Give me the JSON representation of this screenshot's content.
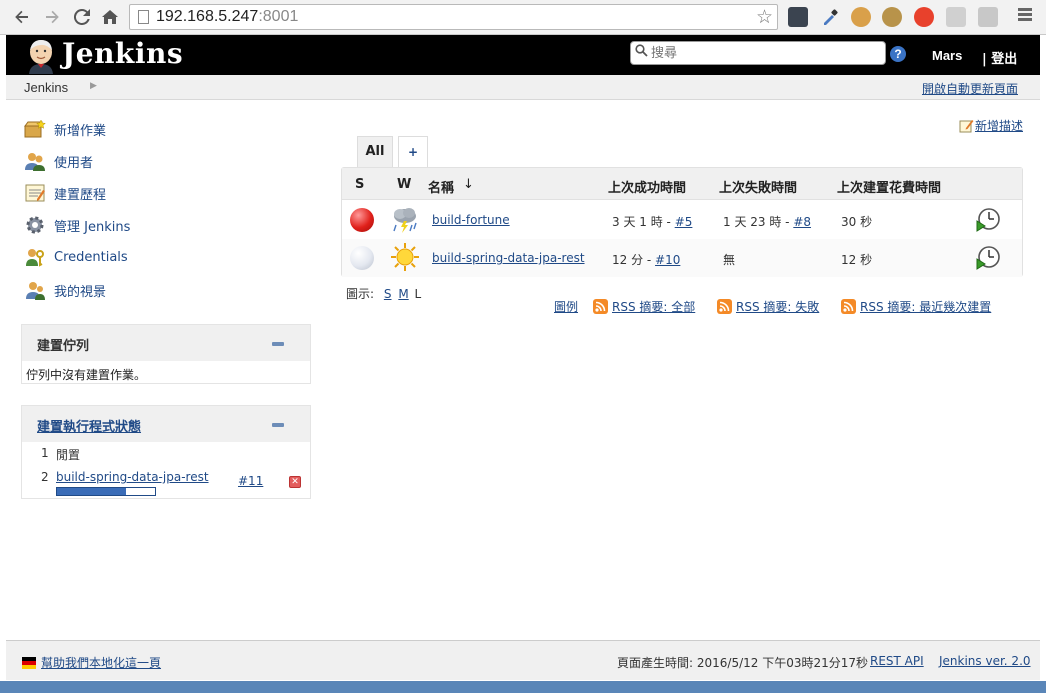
{
  "browser": {
    "url_host": "192.168.5.247",
    "url_port": ":8001"
  },
  "header": {
    "logo": "Jenkins",
    "search_placeholder": "搜尋",
    "user": "Mars",
    "logout": "| 登出"
  },
  "breadcrumb": {
    "root": "Jenkins",
    "auto_refresh": "開啟自動更新頁面"
  },
  "sidebar": {
    "tasks": [
      {
        "label": "新增作業",
        "icon": "new-item-icon"
      },
      {
        "label": "使用者",
        "icon": "people-icon"
      },
      {
        "label": "建置歷程",
        "icon": "build-history-icon"
      },
      {
        "label": "管理 Jenkins",
        "icon": "gear-icon"
      },
      {
        "label": "Credentials",
        "icon": "credentials-icon"
      },
      {
        "label": "我的視景",
        "icon": "user-icon"
      }
    ],
    "build_queue": {
      "title": "建置佇列",
      "empty_text": "佇列中沒有建置作業。"
    },
    "executors": {
      "title": "建置執行程式狀態",
      "rows": [
        {
          "num": "1",
          "status": "閒置"
        },
        {
          "num": "2",
          "job": "build-spring-data-jpa-rest",
          "build": "#11",
          "progress": 0.7
        }
      ]
    }
  },
  "main": {
    "add_description": "新增描述",
    "tabs": [
      {
        "label": "All",
        "active": true
      },
      {
        "label": "+",
        "active": false
      }
    ],
    "columns": {
      "s": "S",
      "w": "W",
      "name": "名稱",
      "sort_arrow": "↓",
      "last_success": "上次成功時間",
      "last_failure": "上次失敗時間",
      "last_duration": "上次建置花費時間"
    },
    "jobs": [
      {
        "status_color": "red",
        "weather": "thunderstorm",
        "name": "build-fortune",
        "last_success": "3 天 1 時 - ",
        "last_success_build": "#5",
        "last_failure": "1 天 23 時 - ",
        "last_failure_build": "#8",
        "last_duration": "30 秒"
      },
      {
        "status_color": "notbuilt",
        "weather": "sunny",
        "name": "build-spring-data-jpa-rest",
        "last_success": "12 分 - ",
        "last_success_build": "#10",
        "last_failure": "無",
        "last_failure_build": "",
        "last_duration": "12 秒"
      }
    ],
    "icon_size_label": "圖示:",
    "icon_sizes": [
      "S",
      "M",
      "L"
    ],
    "legend": "圖例",
    "rss_all": "RSS 摘要: 全部",
    "rss_failed": "RSS 摘要: 失敗",
    "rss_latest": "RSS 摘要: 最近幾次建置"
  },
  "footer": {
    "localize": "幫助我們本地化這一頁",
    "page_generated": "頁面產生時間: 2016/5/12 下午03時21分17秒",
    "rest_api": "REST API",
    "version": "Jenkins ver. 2.0"
  },
  "colors": {
    "header_bg": "#000000",
    "link": "#204a87",
    "panel_bg": "#f0f0f0",
    "status_red": "#e0201a",
    "rss_orange": "#f48a27"
  }
}
